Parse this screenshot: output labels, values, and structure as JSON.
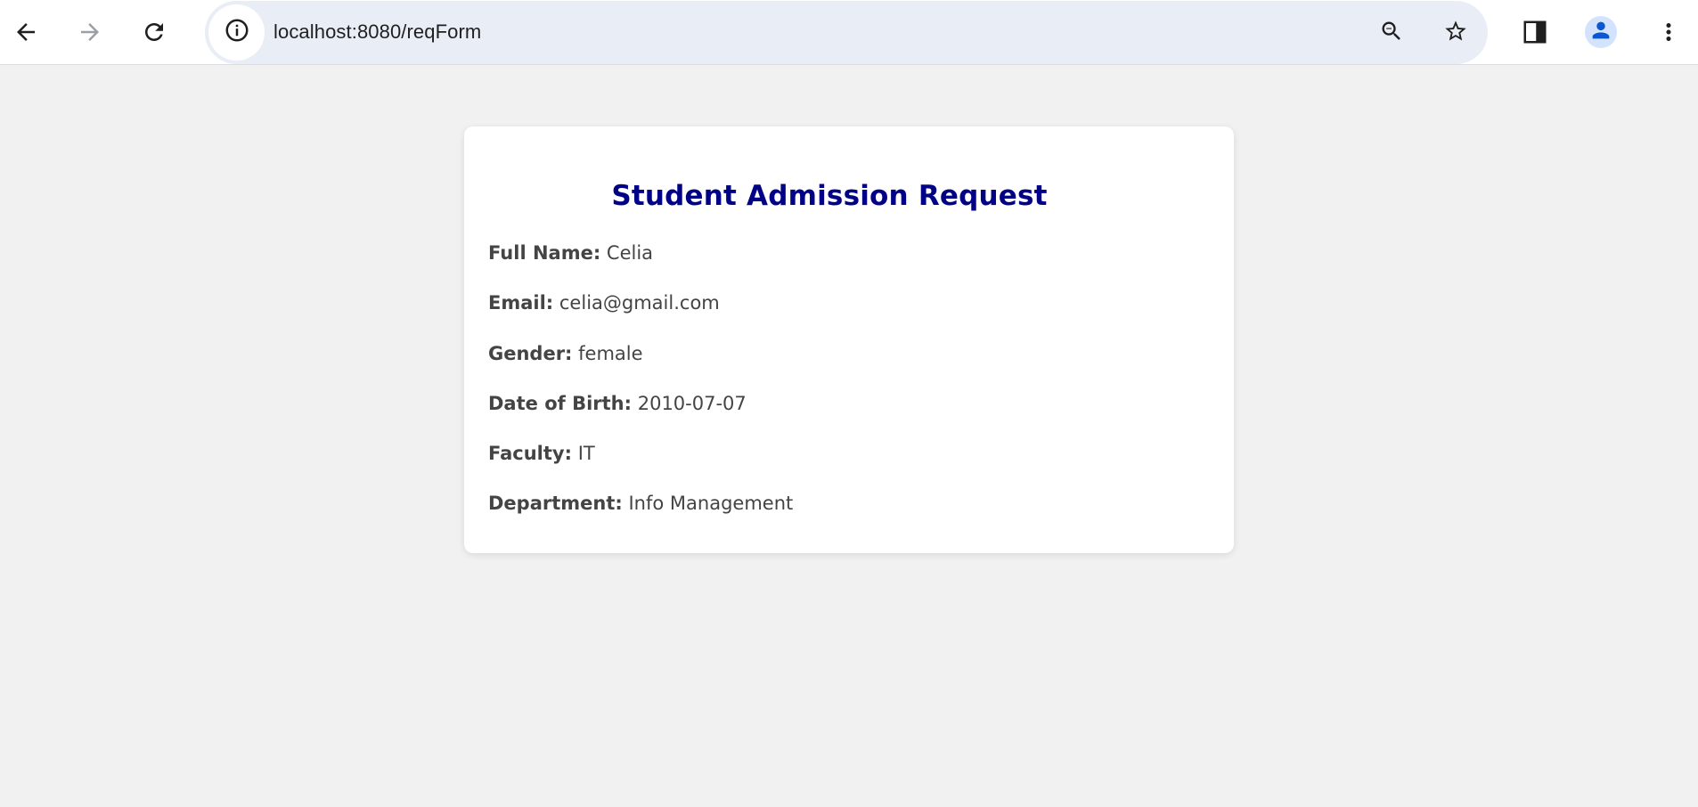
{
  "browser": {
    "url": "localhost:8080/reqForm",
    "icons": {
      "back": "arrow-left-icon",
      "forward": "arrow-right-icon",
      "reload": "reload-icon",
      "site_info": "info-icon",
      "zoom": "zoom-out-icon",
      "bookmark": "star-icon",
      "side_panel": "side-panel-icon",
      "profile": "person-icon",
      "menu": "more-vertical-icon"
    },
    "forward_disabled": true
  },
  "card": {
    "title": "Student Admission Request",
    "fields": [
      {
        "label": "Full Name:",
        "value": "Celia"
      },
      {
        "label": "Email:",
        "value": "celia@gmail.com"
      },
      {
        "label": "Gender:",
        "value": "female"
      },
      {
        "label": "Date of Birth:",
        "value": "2010-07-07"
      },
      {
        "label": "Faculty:",
        "value": "IT"
      },
      {
        "label": "Department:",
        "value": "Info Management"
      }
    ]
  },
  "colors": {
    "page_background": "#f1f1f1",
    "title": "#010185",
    "text": "#444444",
    "omnibox": "#e9edf6",
    "avatar_bg": "#d3e3fd",
    "avatar_fg": "#0b57d0"
  }
}
